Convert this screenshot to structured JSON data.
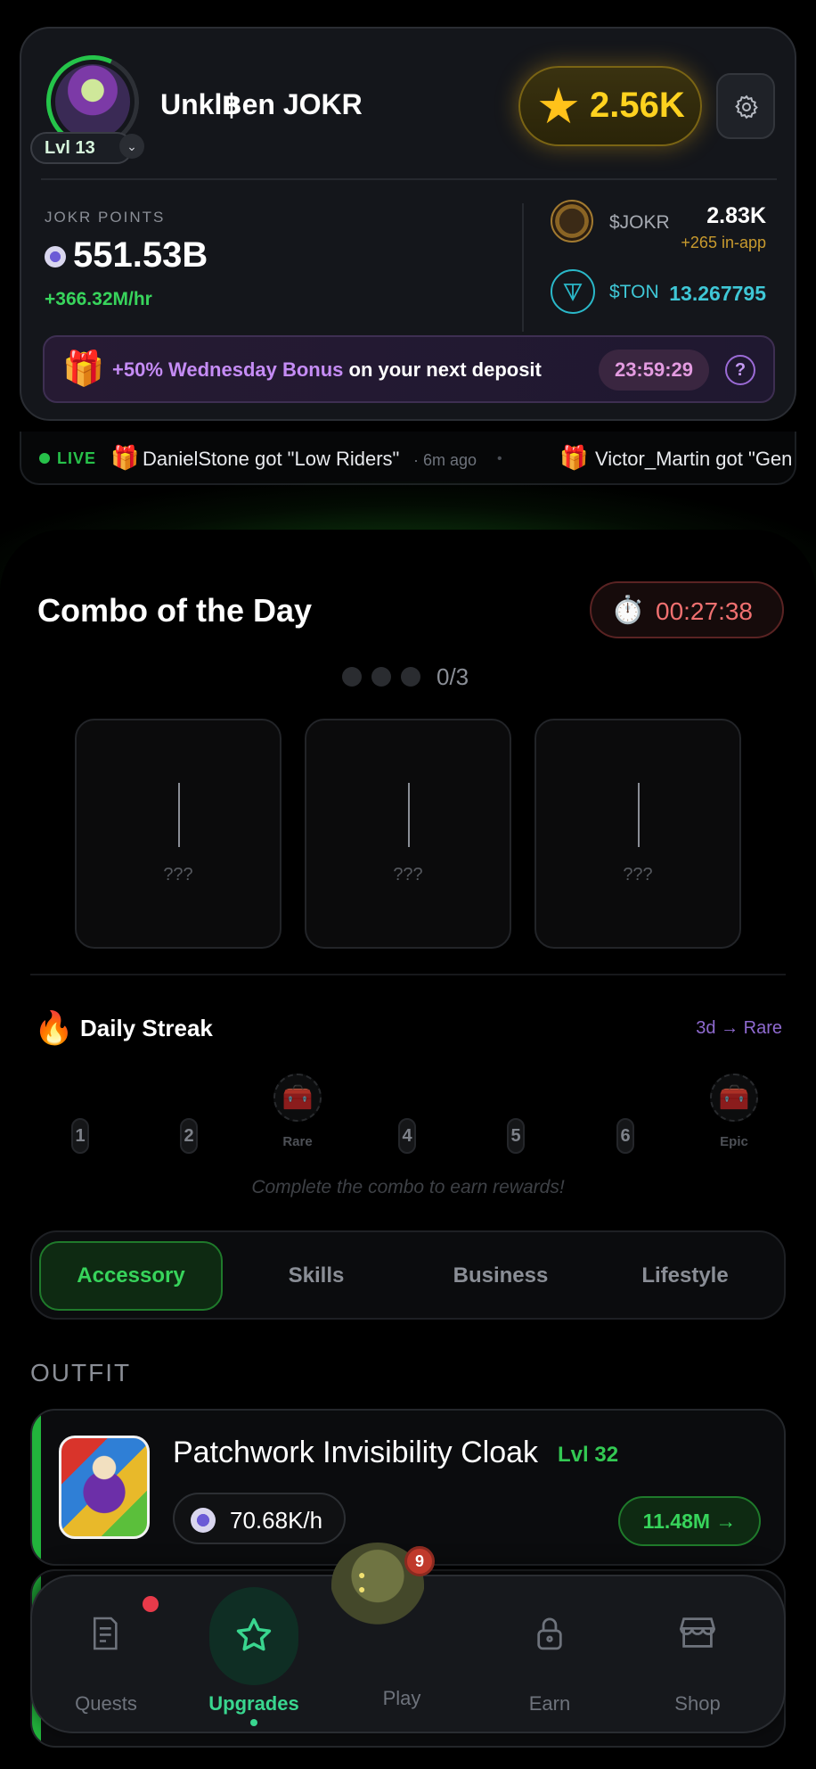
{
  "profile": {
    "username": "Unkl฿en JOKR",
    "level": "Lvl 13",
    "stars": "2.56K"
  },
  "points": {
    "label": "JOKR POINTS",
    "value": "551.53B",
    "rate": "+366.32M/hr"
  },
  "wallet": {
    "jokr_label": "$JOKR",
    "jokr_value": "2.83K",
    "jokr_inapp": "+265 in-app",
    "ton_label": "$TON",
    "ton_value": "13.267795"
  },
  "bonus": {
    "highlight": "+50% Wednesday Bonus",
    "text": " on your next deposit",
    "timer": "23:59:29",
    "help": "?"
  },
  "ticker": {
    "live_label": "LIVE",
    "items": [
      {
        "text": "DanielStone got \"Low Riders\"",
        "time": "· 6m ago"
      },
      {
        "text": "Victor_Martin got \"Gen",
        "time": ""
      }
    ]
  },
  "combo": {
    "title": "Combo of the Day",
    "timer": "00:27:38",
    "progress": "0/3",
    "cards": [
      "???",
      "???",
      "???"
    ]
  },
  "streak": {
    "title": "Daily Streak",
    "target": "3d → Rare",
    "days": [
      "1",
      "2",
      "4",
      "5",
      "6"
    ],
    "rare_label": "Rare",
    "epic_label": "Epic",
    "hint": "Complete the combo to earn rewards!"
  },
  "categories": {
    "tabs": [
      "Accessory",
      "Skills",
      "Business",
      "Lifestyle"
    ],
    "active": "Accessory"
  },
  "outfit": {
    "heading": "OUTFIT",
    "item": {
      "name": "Patchwork Invisibility Cloak",
      "level": "Lvl 32",
      "rate": "70.68K/h",
      "cost": "11.48M →"
    }
  },
  "nav": {
    "quests": "Quests",
    "upgrades": "Upgrades",
    "play": "Play",
    "play_badge": "9",
    "earn": "Earn",
    "shop": "Shop"
  },
  "colors": {
    "accent_green": "#37d45b",
    "gold": "#ffd21f",
    "ton_cyan": "#3fc7d6",
    "bonus_purple": "#c58cf5",
    "timer_red": "#f07070"
  }
}
